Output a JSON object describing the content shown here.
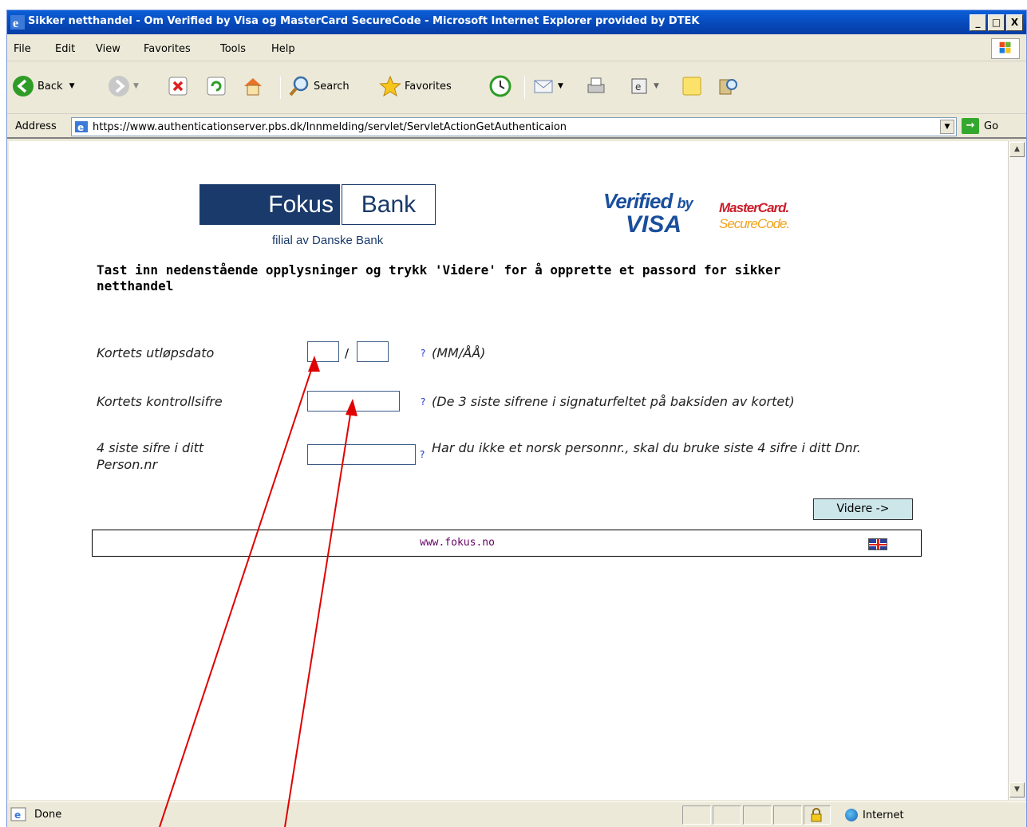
{
  "window": {
    "title": "Sikker netthandel - Om Verified by Visa og MasterCard SecureCode - Microsoft Internet Explorer provided by DTEK",
    "minimize": "_",
    "maximize": "□",
    "close": "X"
  },
  "menu": [
    "File",
    "Edit",
    "View",
    "Favorites",
    "Tools",
    "Help"
  ],
  "toolbar": {
    "back": "Back",
    "search": "Search",
    "favorites": "Favorites"
  },
  "address": {
    "label": "Address",
    "url": "https://www.authenticationserver.pbs.dk/Innmelding/servlet/ServletActionGetAuthenticaion",
    "go": "Go"
  },
  "page": {
    "logo_left": "Fokus",
    "logo_right": "Bank",
    "logo_sub": "filial av Danske Bank",
    "visa_verified": "Verified",
    "visa_by": "by",
    "visa_word": "VISA",
    "mc_line1": "MasterCard.",
    "mc_line2": "SecureCode.",
    "instruction": "Tast inn nedenstående opplysninger og trykk 'Videre' for å opprette et passord for sikker netthandel",
    "expiry": {
      "label": "Kortets utløpsdato",
      "slash": "/",
      "help": "?",
      "hint": "(MM/ÅÅ)"
    },
    "cvc": {
      "label": "Kortets kontrollsifre",
      "help": "?",
      "hint": "(De 3 siste sifrene i signaturfeltet på baksiden av kortet)"
    },
    "personnr": {
      "label": "4 siste sifre i ditt Person.nr",
      "help": "?",
      "hint": "Har du ikke et norsk personnr., skal du bruke siste 4 sifre i ditt Dnr."
    },
    "submit": "Videre ->",
    "footer_link": "www.fokus.no"
  },
  "status": {
    "text": "Done",
    "zone": "Internet"
  },
  "colors": {
    "annotation": "#e00000",
    "bank_navy": "#1a3a6b",
    "button_bg": "#cce6ea"
  }
}
